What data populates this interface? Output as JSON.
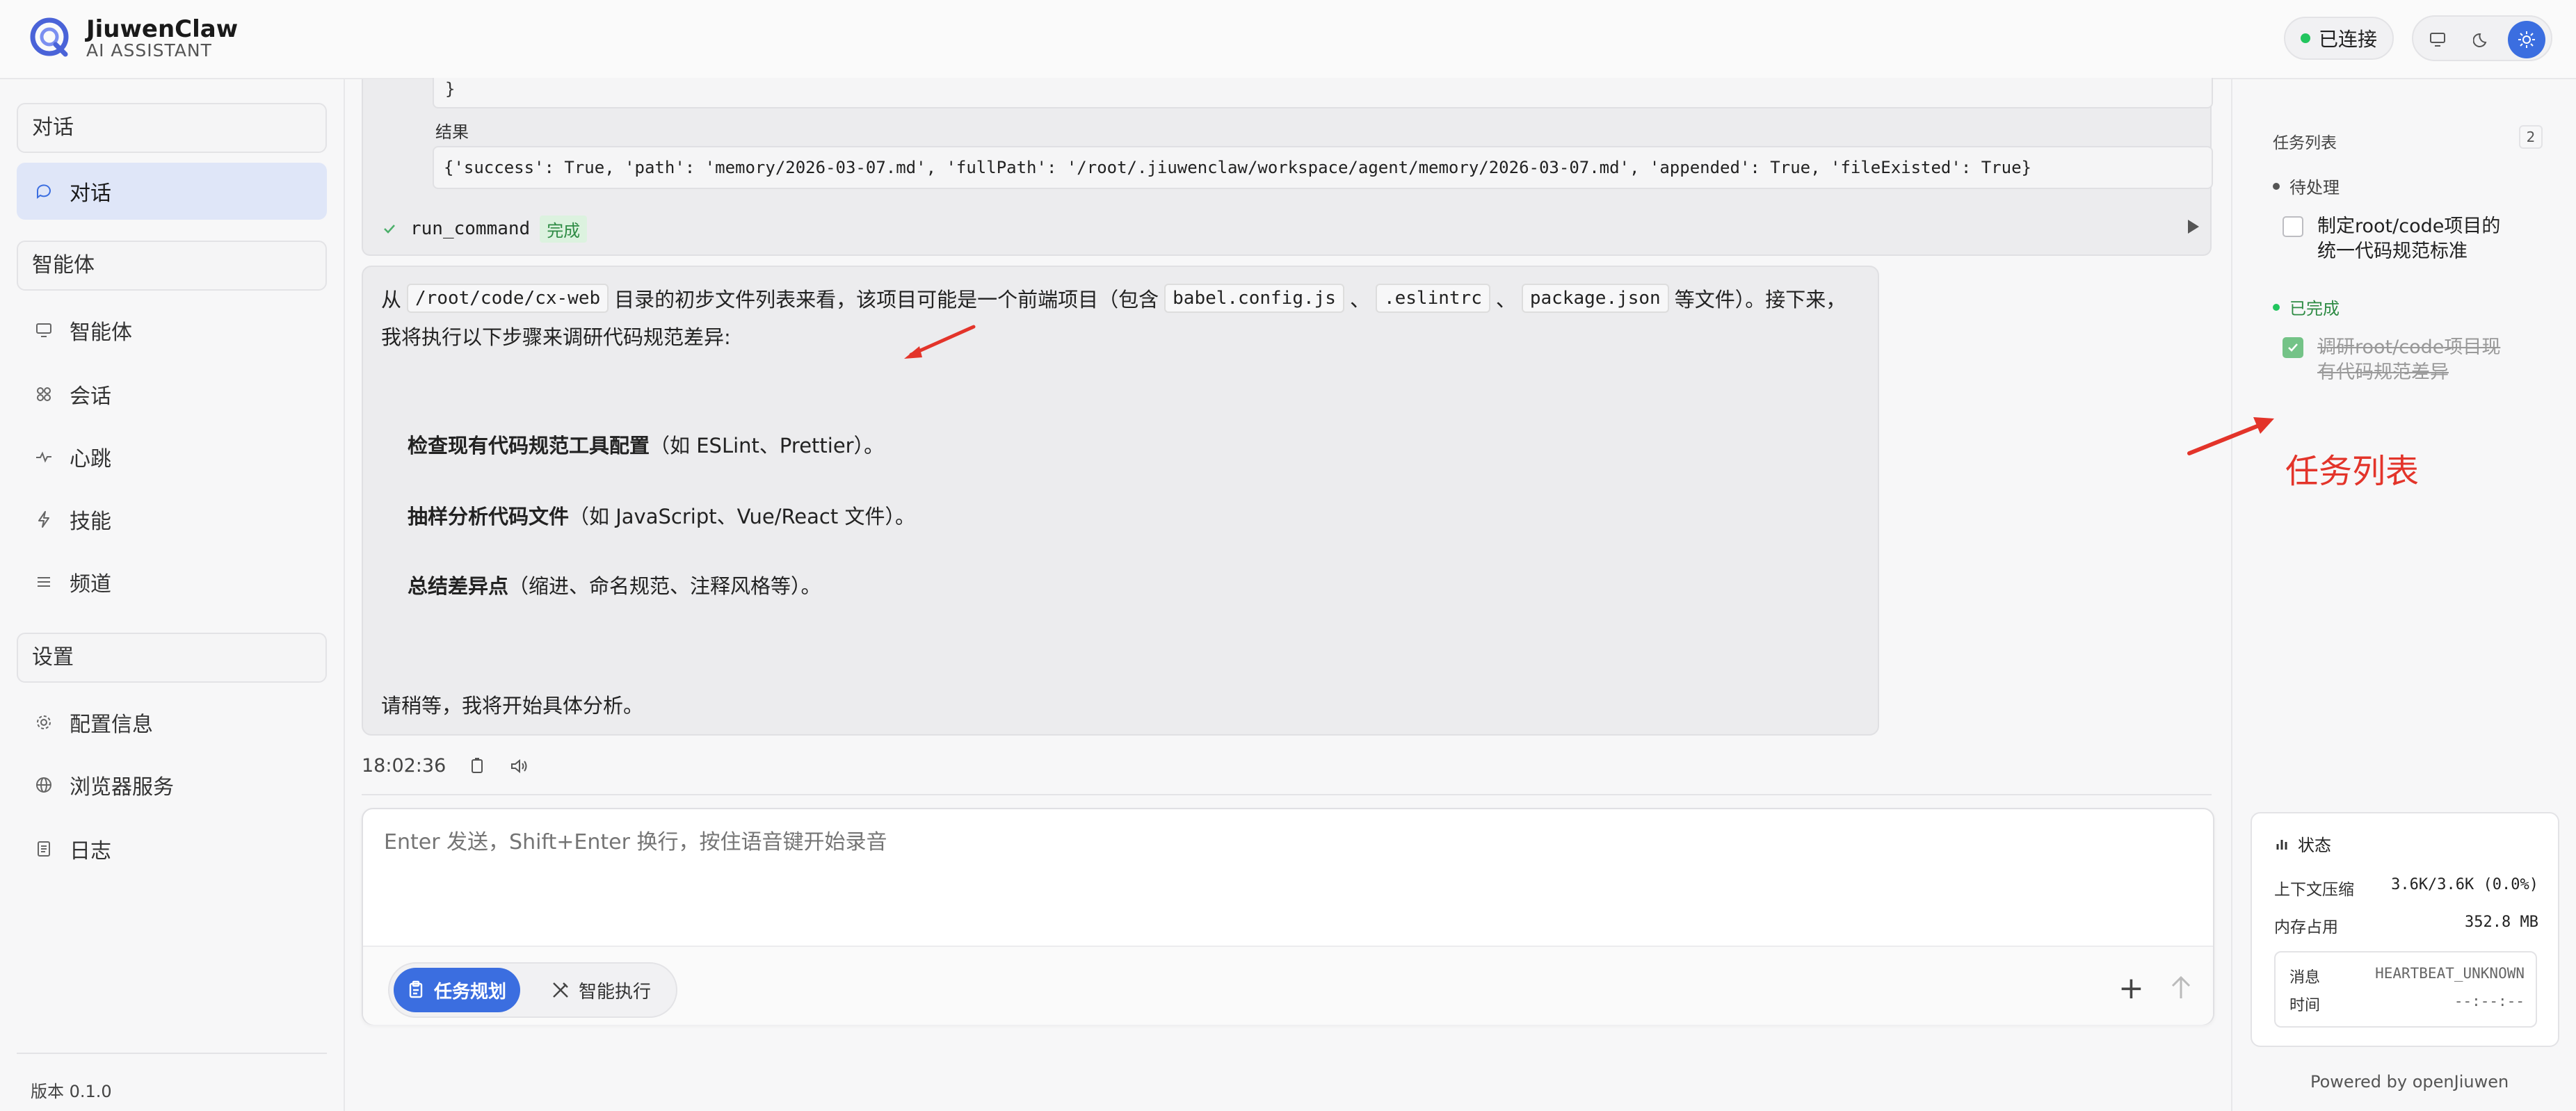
{
  "header": {
    "brand_name": "JiuwenClaw",
    "brand_sub": "AI ASSISTANT",
    "connection_status": "已连接"
  },
  "sidebar": {
    "groups": {
      "chat": "对话",
      "agents": "智能体",
      "settings": "设置"
    },
    "items": [
      {
        "label": "对话",
        "icon": "chat-bubble-icon"
      },
      {
        "label": "智能体",
        "icon": "monitor-icon"
      },
      {
        "label": "会话",
        "icon": "network-icon"
      },
      {
        "label": "心跳",
        "icon": "pulse-icon"
      },
      {
        "label": "技能",
        "icon": "bolt-icon"
      },
      {
        "label": "频道",
        "icon": "list-icon"
      },
      {
        "label": "配置信息",
        "icon": "gear-icon"
      },
      {
        "label": "浏览器服务",
        "icon": "globe-icon"
      },
      {
        "label": "日志",
        "icon": "document-icon"
      }
    ],
    "version": "版本 0.1.0"
  },
  "tool_result": {
    "brace": "}",
    "label": "结果",
    "value": "{'success': True, 'path': 'memory/2026-03-07.md', 'fullPath': '/root/.jiuwenclaw/workspace/agent/memory/2026-03-07.md', 'appended': True, 'fileExisted': True}",
    "command": "run_command",
    "command_status": "完成"
  },
  "message": {
    "prefix": "从",
    "path_chip": "/root/code/cx-web",
    "mid1": "目录的初步文件列表来看，该项目可能是一个前端项目（包含",
    "chip1": "babel.config.js",
    "sep1": "、",
    "chip2": ".eslintrc",
    "sep2": "、",
    "chip3": "package.json",
    "tail": "等文件）。接下来，",
    "line2": "我将执行以下步骤来调研代码规范差异:",
    "steps": [
      {
        "bold": "检查现有代码规范工具配置",
        "rest": "（如 ESLint、Prettier）。"
      },
      {
        "bold": "抽样分析代码文件",
        "rest": "（如 JavaScript、Vue/React 文件）。"
      },
      {
        "bold": "总结差异点",
        "rest": "（缩进、命名规范、注释风格等）。"
      }
    ],
    "closing": "请稍等，我将开始具体分析。",
    "time": "18:02:36"
  },
  "composer": {
    "placeholder": "Enter 发送，Shift+Enter 换行，按住语音键开始录音",
    "mode_active": "任务规划",
    "mode_idle": "智能执行"
  },
  "tasks": {
    "title": "任务列表",
    "count": "2",
    "pending_label": "待处理",
    "done_label": "已完成",
    "pending": [
      "制定root/code项目的统一代码规范标准"
    ],
    "done": [
      "调研root/code项目现有代码规范差异"
    ]
  },
  "annotation": {
    "text": "任务列表",
    "color": "#e3342a"
  },
  "status": {
    "title": "状态",
    "context_label": "上下文压缩",
    "context_value": "3.6K/3.6K (0.0%)",
    "memory_label": "内存占用",
    "memory_value": "352.8 MB",
    "msg_label": "消息",
    "msg_value": "HEARTBEAT_UNKNOWN",
    "time_label": "时间",
    "time_value": "--:--:--"
  },
  "footer": {
    "powered": "Powered by openJiuwen"
  },
  "colors": {
    "accent": "#3b6ee0",
    "connected": "#22c55e",
    "done_green": "#2e8b44"
  }
}
